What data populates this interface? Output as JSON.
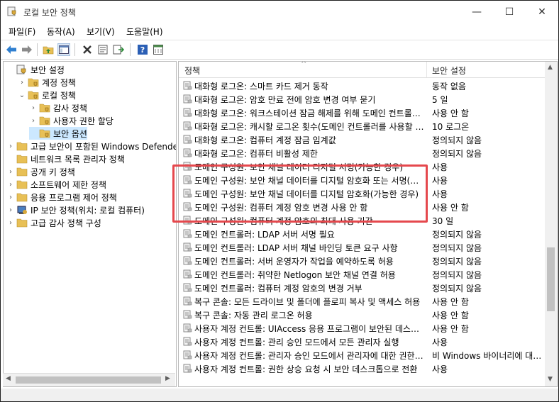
{
  "window": {
    "title": "로컬 보안 정책",
    "min_glyph": "—",
    "max_glyph": "☐",
    "close_glyph": "✕"
  },
  "menu": [
    "파일(F)",
    "동작(A)",
    "보기(V)",
    "도움말(H)"
  ],
  "toolbar_icons": [
    "back-icon",
    "forward-icon",
    "up-folder-icon",
    "show-hide-tree-icon",
    "delete-icon",
    "properties-icon",
    "export-icon",
    "help-icon",
    "view-icon"
  ],
  "tree": [
    {
      "label": "보안 설정",
      "indent": 0,
      "expander": "",
      "icon": "security-icon"
    },
    {
      "label": "계정 정책",
      "indent": 1,
      "expander": "›",
      "icon": "folder-icon"
    },
    {
      "label": "로컬 정책",
      "indent": 1,
      "expander": "⌄",
      "icon": "folder-open-icon"
    },
    {
      "label": "감사 정책",
      "indent": 2,
      "expander": "›",
      "icon": "folder-icon"
    },
    {
      "label": "사용자 권한 할당",
      "indent": 2,
      "expander": "›",
      "icon": "folder-icon"
    },
    {
      "label": "보안 옵션",
      "indent": 2,
      "expander": "",
      "icon": "folder-icon",
      "selected": true
    },
    {
      "label": "고급 보안이 포함된 Windows Defender",
      "indent": 0,
      "expander": "›",
      "icon": "folder-icon"
    },
    {
      "label": "네트워크 목록 관리자 정책",
      "indent": 0,
      "expander": "",
      "icon": "folder-icon"
    },
    {
      "label": "공개 키 정책",
      "indent": 0,
      "expander": "›",
      "icon": "folder-icon"
    },
    {
      "label": "소프트웨어 제한 정책",
      "indent": 0,
      "expander": "›",
      "icon": "folder-icon"
    },
    {
      "label": "응용 프로그램 제어 정책",
      "indent": 0,
      "expander": "›",
      "icon": "folder-icon"
    },
    {
      "label": "IP 보안 정책(위치: 로컬 컴퓨터)",
      "indent": 0,
      "expander": "›",
      "icon": "ip-security-icon"
    },
    {
      "label": "고급 감사 정책 구성",
      "indent": 0,
      "expander": "›",
      "icon": "folder-icon"
    }
  ],
  "list": {
    "headers": {
      "policy": "정책",
      "setting": "보안 설정"
    },
    "rows": [
      {
        "policy": "대화형 로그온: 스마트 카드 제거 동작",
        "setting": "동작 없음"
      },
      {
        "policy": "대화형 로그온: 암호 만료 전에 암호 변경 여부 묻기",
        "setting": "5 일"
      },
      {
        "policy": "대화형 로그온: 워크스테이션 잠금 해제를 위해 도메인 컨트롤러 인증 필요",
        "setting": "사용 안 함"
      },
      {
        "policy": "대화형 로그온: 캐시할 로그온 횟수(도메인 컨트롤러를 사용할 수 없는 경우)",
        "setting": "10 로그온"
      },
      {
        "policy": "대화형 로그온: 컴퓨터 계정 잠금 임계값",
        "setting": "정의되지 않음"
      },
      {
        "policy": "대화형 로그온: 컴퓨터 비활성 제한",
        "setting": "정의되지 않음"
      },
      {
        "policy": "도메인 구성원: 보안 채널 데이터 디지털 서명(가능한 경우)",
        "setting": "사용"
      },
      {
        "policy": "도메인 구성원: 보안 채널 데이터를 디지털 암호화 또는 서명(항상)",
        "setting": "사용"
      },
      {
        "policy": "도메인 구성원: 보안 채널 데이터를 디지털 암호화(가능한 경우)",
        "setting": "사용"
      },
      {
        "policy": "도메인 구성원: 컴퓨터 계정 암호 변경 사용 안 함",
        "setting": "사용 안 함"
      },
      {
        "policy": "도메인 구성원: 컴퓨터 계정 암호의 최대 사용 기간",
        "setting": "30 일"
      },
      {
        "policy": "도메인 컨트롤러: LDAP 서버 서명 필요",
        "setting": "정의되지 않음"
      },
      {
        "policy": "도메인 컨트롤러: LDAP 서버 채널 바인딩 토큰 요구 사항",
        "setting": "정의되지 않음"
      },
      {
        "policy": "도메인 컨트롤러: 서버 운영자가 작업을 예약하도록 허용",
        "setting": "정의되지 않음"
      },
      {
        "policy": "도메인 컨트롤러: 취약한 Netlogon 보안 채널 연결 허용",
        "setting": "정의되지 않음"
      },
      {
        "policy": "도메인 컨트롤러: 컴퓨터 계정 암호의 변경 거부",
        "setting": "정의되지 않음"
      },
      {
        "policy": "복구 콘솔: 모든 드라이브 및 폴더에 플로피 복사 및 액세스 허용",
        "setting": "사용 안 함"
      },
      {
        "policy": "복구 콘솔: 자동 관리 로그온 허용",
        "setting": "사용 안 함"
      },
      {
        "policy": "사용자 계정 컨트롤: UIAccess 응용 프로그램이 보안된 데스크톱을 사용하지 않고",
        "setting": "사용 안 함"
      },
      {
        "policy": "사용자 계정 컨트롤: 관리 승인 모드에서 모든 관리자 실행",
        "setting": "사용"
      },
      {
        "policy": "사용자 계정 컨트롤: 관리자 승인 모드에서 관리자에 대한 권한 상승 확인",
        "setting": "비 Windows 바이너리에 대한 동의 확인"
      },
      {
        "policy": "사용자 계정 컨트롤: 권한 상승 요청 시 보안 데스크톱으로 전환",
        "setting": "사용"
      }
    ]
  },
  "colors": {
    "highlight_box": "#e5484d",
    "selection": "#cce8ff",
    "folder": "#e8c056"
  }
}
